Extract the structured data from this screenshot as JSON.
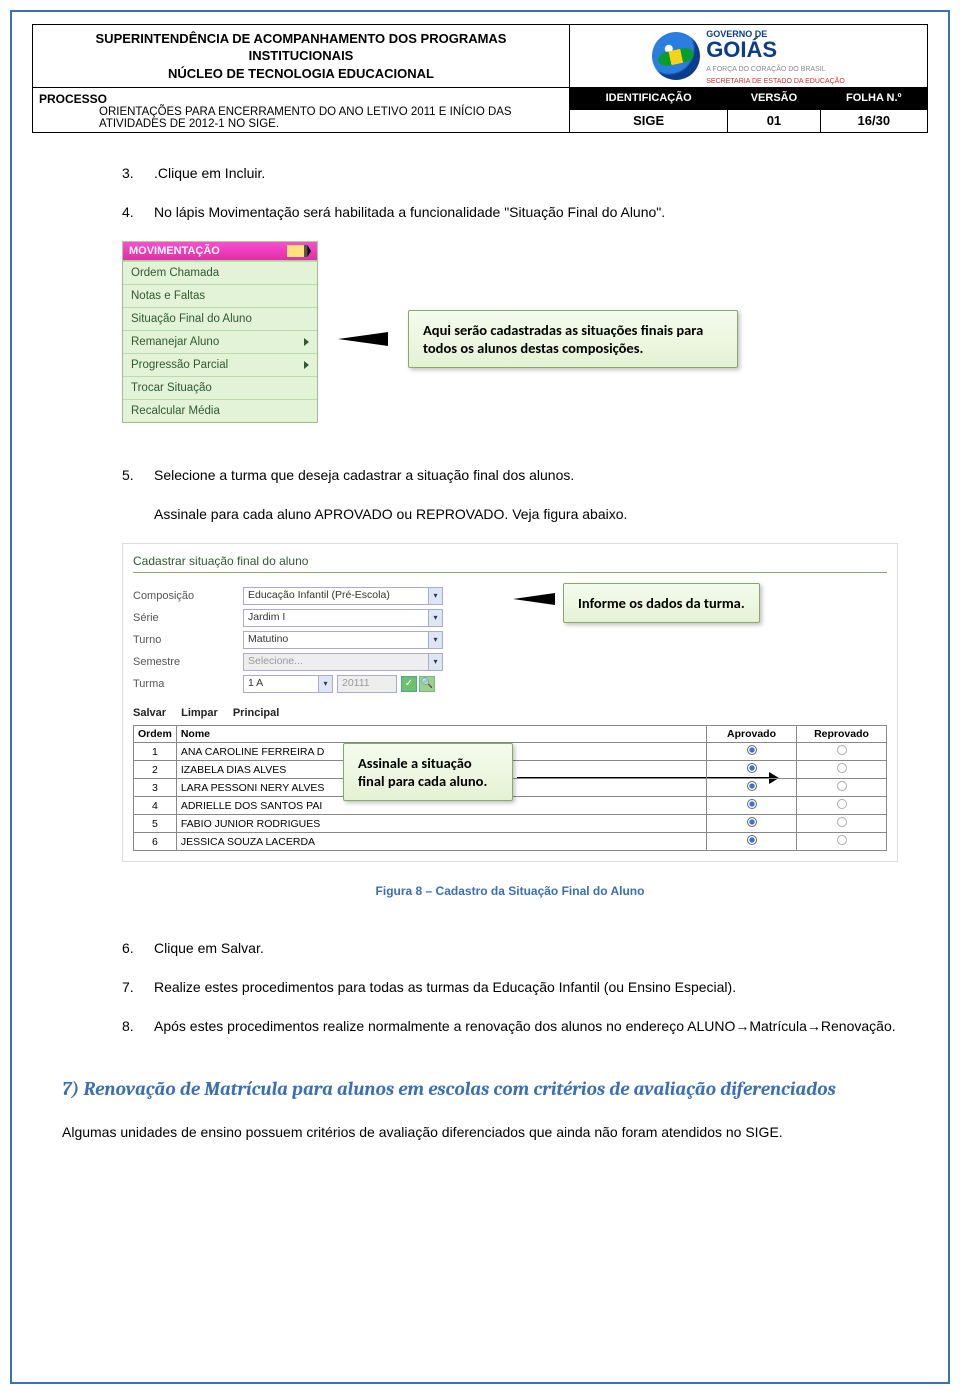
{
  "header": {
    "org_line1": "SUPERINTENDÊNCIA DE ACOMPANHAMENTO DOS PROGRAMAS",
    "org_line2": "INSTITUCIONAIS",
    "org_line3": "NÚCLEO DE TECNOLOGIA EDUCACIONAL",
    "logo": {
      "gov": "GOVERNO DE",
      "state": "GOIÁS",
      "tagline": "A FORÇA DO CORAÇÃO DO BRASIL",
      "secretaria": "SECRETARIA DE ESTADO DA EDUCAÇÃO"
    },
    "processo_label": "PROCESSO",
    "processo_sub": "ORIENTAÇÕES PARA ENCERRAMENTO DO ANO LETIVO 2011 E INÍCIO DAS ATIVIDADES DE 2012-1 NO SIGE.",
    "identificacao_h": "IDENTIFICAÇÃO",
    "versao_h": "VERSÃO",
    "folha_h": "FOLHA N.º",
    "identificacao": "SIGE",
    "versao": "01",
    "folha": "16/30"
  },
  "steps": {
    "s3": {
      "n": "3.",
      "t": ".Clique em Incluir."
    },
    "s4": {
      "n": "4.",
      "t": "No lápis Movimentação será habilitada a funcionalidade \"Situação Final do Aluno\"."
    },
    "s5a": {
      "n": "5.",
      "t": "Selecione a turma que deseja cadastrar a situação final dos alunos."
    },
    "s5b": "Assinale para cada aluno APROVADO ou REPROVADO. Veja figura abaixo.",
    "s6": {
      "n": "6.",
      "t": "Clique em Salvar."
    },
    "s7": {
      "n": "7.",
      "t": "Realize estes procedimentos para todas as turmas da Educação Infantil (ou Ensino Especial)."
    },
    "s8": {
      "n": "8.",
      "t": "Após estes procedimentos realize normalmente a renovação dos alunos no endereço ALUNO→Matrícula→Renovação."
    }
  },
  "mov_menu": {
    "title": "MOVIMENTAÇÃO",
    "items": [
      "Ordem Chamada",
      "Notas e Faltas",
      "Situação Final do Aluno",
      "Remanejar Aluno",
      "Progressão Parcial",
      "Trocar Situação",
      "Recalcular Média"
    ]
  },
  "callout1": "Aqui serão cadastradas as situações finais para todos os alunos destas composições.",
  "form": {
    "title": "Cadastrar situação final do aluno",
    "labels": {
      "composicao": "Composição",
      "serie": "Série",
      "turno": "Turno",
      "semestre": "Semestre",
      "turma": "Turma"
    },
    "values": {
      "composicao": "Educação Infantil (Pré-Escola)",
      "serie": "Jardim I",
      "turno": "Matutino",
      "semestre": "Selecione...",
      "turma": "1 A",
      "turma_code": "20111"
    },
    "callout": "Informe os dados da turma.",
    "buttons": {
      "salvar": "Salvar",
      "limpar": "Limpar",
      "principal": "Principal"
    }
  },
  "grid": {
    "headers": {
      "ordem": "Ordem",
      "nome": "Nome",
      "aprovado": "Aprovado",
      "reprovado": "Reprovado"
    },
    "rows": [
      {
        "n": "1",
        "nome": "ANA CAROLINE FERREIRA D"
      },
      {
        "n": "2",
        "nome": "IZABELA DIAS ALVES"
      },
      {
        "n": "3",
        "nome": "LARA PESSONI NERY ALVES"
      },
      {
        "n": "4",
        "nome": "ADRIELLE DOS SANTOS PAI"
      },
      {
        "n": "5",
        "nome": "FABIO JUNIOR RODRIGUES"
      },
      {
        "n": "6",
        "nome": "JESSICA SOUZA LACERDA"
      }
    ],
    "callout": "Assinale a situação final para cada aluno."
  },
  "figure_caption": "Figura 8 – Cadastro da Situação Final do Aluno",
  "section7": {
    "heading": "7) Renovação de Matrícula para alunos em escolas com critérios de avaliação diferenciados",
    "para": "Algumas unidades de ensino possuem critérios de avaliação diferenciados que ainda não foram atendidos no SIGE."
  }
}
